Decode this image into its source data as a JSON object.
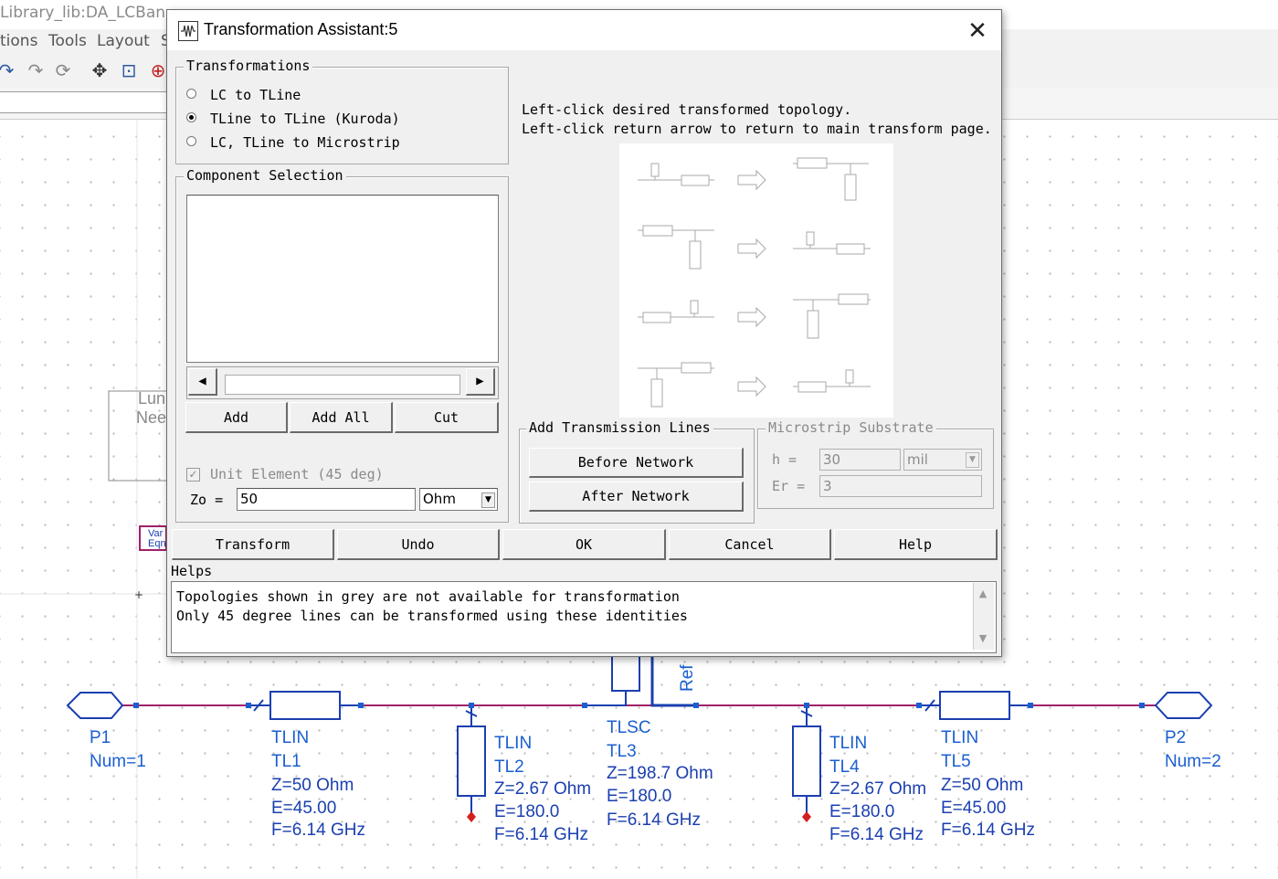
{
  "background_app": {
    "title": "Library_lib:DA_LCBan",
    "menu": [
      "tions",
      "Tools",
      "Layout",
      "S"
    ]
  },
  "schematic": {
    "ports": [
      {
        "label": "P1",
        "param": "Num=1"
      },
      {
        "label": "P2",
        "param": "Num=2"
      }
    ],
    "components": [
      {
        "type": "TLIN",
        "name": "TL1",
        "z": "Z=50 Ohm",
        "e": "E=45.00",
        "f": "F=6.14 GHz"
      },
      {
        "type": "TLIN",
        "name": "TL2",
        "z": "Z=2.67 Ohm",
        "e": "E=180.0",
        "f": "F=6.14 GHz"
      },
      {
        "type": "TLSC",
        "name": "TL3",
        "z": "Z=198.7 Ohm",
        "e": "E=180.0",
        "f": "F=6.14 GHz"
      },
      {
        "type": "TLIN",
        "name": "TL4",
        "z": "Z=2.67 Ohm",
        "e": "E=180.0",
        "f": "F=6.14 GHz"
      },
      {
        "type": "TLIN",
        "name": "TL5",
        "z": "Z=50 Ohm",
        "e": "E=45.00",
        "f": "F=6.14 GHz"
      }
    ],
    "ref_label": "Ref",
    "lumped_box": [
      "Lun",
      "Nee"
    ],
    "var_box": [
      "Var",
      "Eqn"
    ]
  },
  "dialog": {
    "title": "Transformation Assistant:5",
    "transformations": {
      "label": "Transformations",
      "options": [
        "LC to TLine",
        "TLine to TLine (Kuroda)",
        "LC, TLine to Microstrip"
      ],
      "selected_index": 1
    },
    "component_selection": {
      "label": "Component Selection",
      "buttons": [
        "Add",
        "Add All",
        "Cut"
      ],
      "unit_element_label": "Unit Element (45 deg)",
      "zo_label": "Zo =",
      "zo_value": "50",
      "zo_unit": "Ohm"
    },
    "instructions": [
      "Left-click desired transformed topology.",
      "Left-click return arrow to return to main transform page."
    ],
    "add_lines": {
      "label": "Add Transmission Lines",
      "before": "Before Network",
      "after": "After Network"
    },
    "substrate": {
      "label": "Microstrip Substrate",
      "h_label": "h =",
      "h_value": "30",
      "h_unit": "mil",
      "er_label": "Er =",
      "er_value": "3"
    },
    "bottom_buttons": [
      "Transform",
      "Undo",
      "OK",
      "Cancel",
      "Help"
    ],
    "helps": {
      "label": "Helps",
      "lines": [
        "Topologies shown in grey are not available for transformation",
        "Only 45 degree lines can be transformed using these identities"
      ]
    }
  },
  "colors": {
    "wire": "#a0206a",
    "component": "#1a3fb0",
    "text_blue": "#1a5fd0",
    "port_node": "#d02020"
  }
}
